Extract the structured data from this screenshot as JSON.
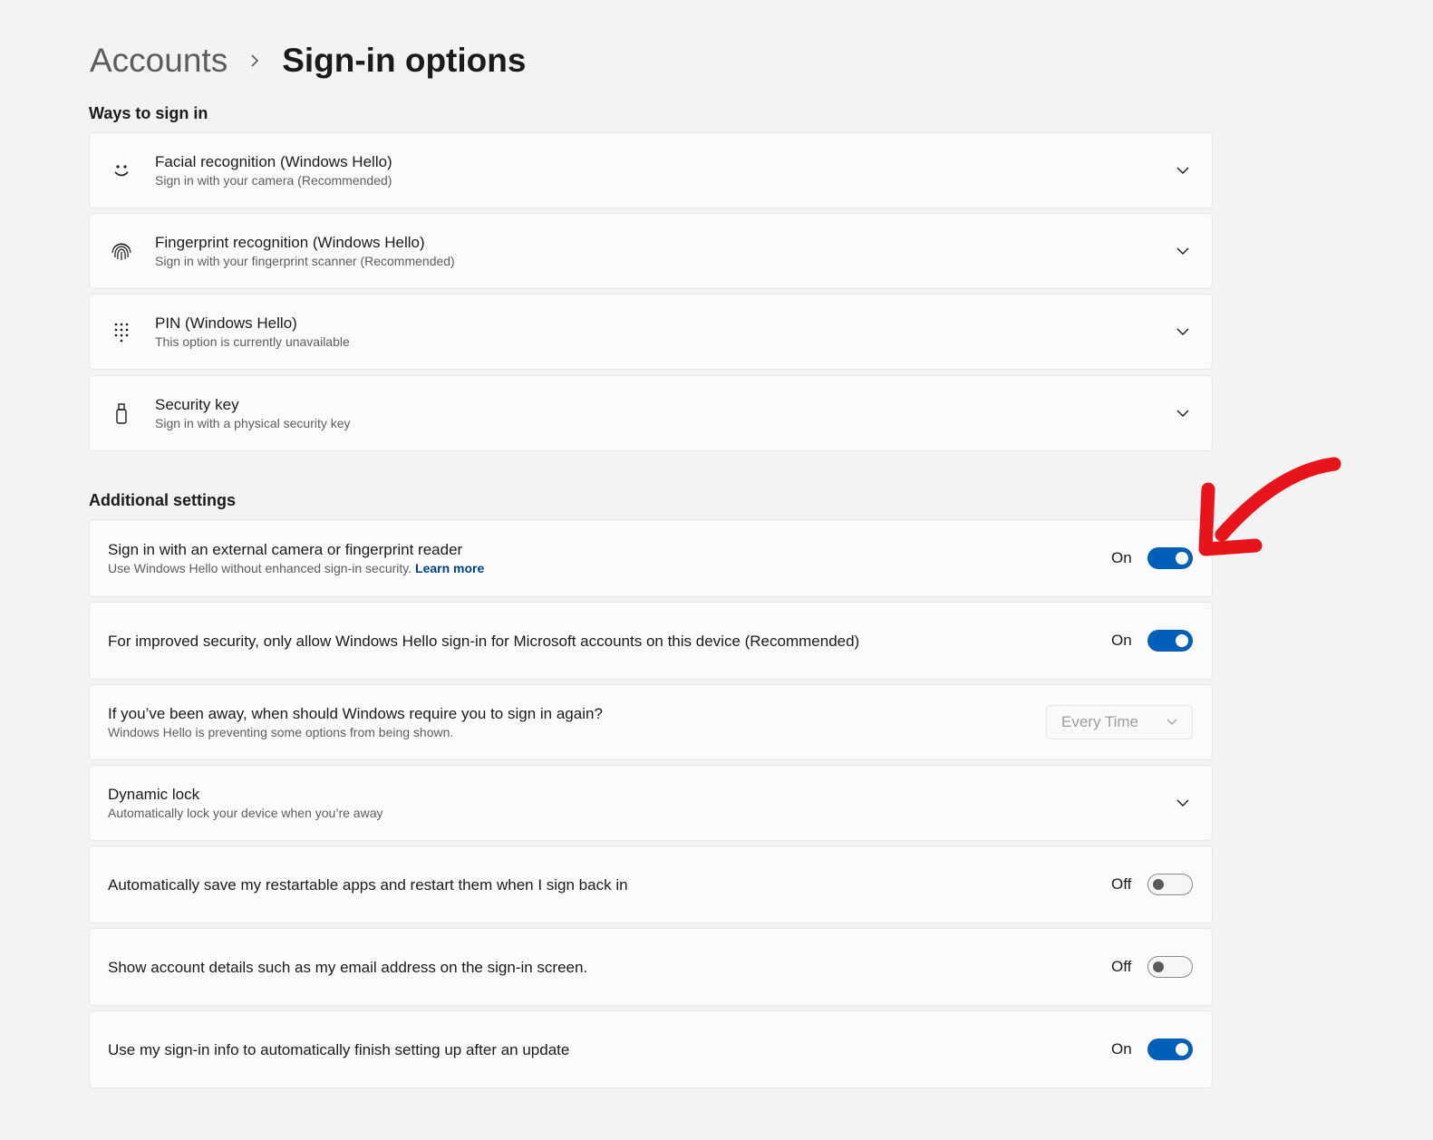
{
  "breadcrumb": {
    "parent": "Accounts",
    "current": "Sign-in options"
  },
  "ways_section": {
    "heading": "Ways to sign in",
    "items": [
      {
        "title": "Facial recognition (Windows Hello)",
        "subtitle": "Sign in with your camera (Recommended)",
        "icon": "face-icon"
      },
      {
        "title": "Fingerprint recognition (Windows Hello)",
        "subtitle": "Sign in with your fingerprint scanner (Recommended)",
        "icon": "fingerprint-icon"
      },
      {
        "title": "PIN (Windows Hello)",
        "subtitle": "This option is currently unavailable",
        "icon": "keypad-icon"
      },
      {
        "title": "Security key",
        "subtitle": "Sign in with a physical security key",
        "icon": "usb-key-icon"
      }
    ]
  },
  "additional_section": {
    "heading": "Additional settings",
    "external_camera": {
      "title": "Sign in with an external camera or fingerprint reader",
      "subtitle": "Use Windows Hello without enhanced sign-in security.",
      "link": "Learn more",
      "state_label": "On",
      "on": true
    },
    "hello_only": {
      "title": "For improved security, only allow Windows Hello sign-in for Microsoft accounts on this device (Recommended)",
      "state_label": "On",
      "on": true
    },
    "away": {
      "title": "If you’ve been away, when should Windows require you to sign in again?",
      "subtitle": "Windows Hello is preventing some options from being shown.",
      "selected": "Every Time"
    },
    "dynamic_lock": {
      "title": "Dynamic lock",
      "subtitle": "Automatically lock your device when you’re away"
    },
    "restart_apps": {
      "title": "Automatically save my restartable apps and restart them when I sign back in",
      "state_label": "Off",
      "on": false
    },
    "account_details": {
      "title": "Show account details such as my email address on the sign-in screen.",
      "state_label": "Off",
      "on": false
    },
    "update_signin": {
      "title": "Use my sign-in info to automatically finish setting up after an update",
      "state_label": "On",
      "on": true
    }
  },
  "colors": {
    "accent": "#005fb8",
    "annotation": "#e8141b",
    "link": "#003e92"
  }
}
